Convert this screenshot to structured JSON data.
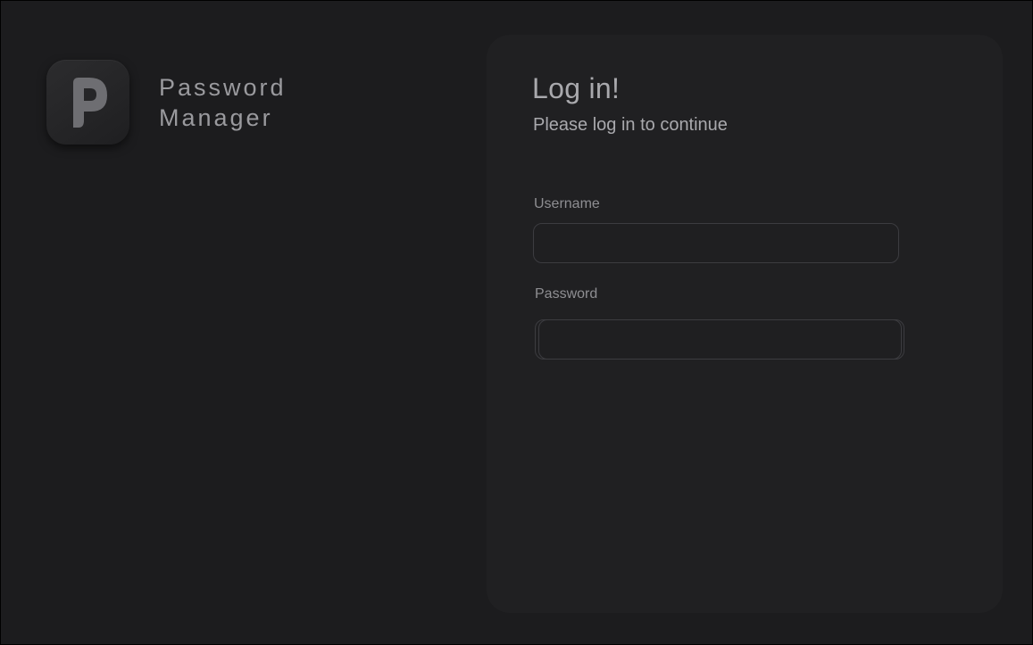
{
  "app": {
    "title_line1": "Password",
    "title_line2": "Manager",
    "logo_icon": "p-logo-icon"
  },
  "login": {
    "heading": "Log in!",
    "subheading": "Please log in to continue",
    "username_label": "Username",
    "username_value": "",
    "username_placeholder": "",
    "password_label": "Password",
    "password_value": "",
    "password_placeholder": ""
  },
  "colors": {
    "background": "#1c1c1e",
    "card": "#202022",
    "text": "#a9a9ad",
    "label": "#8e8e92",
    "border": "#3c3c40"
  }
}
